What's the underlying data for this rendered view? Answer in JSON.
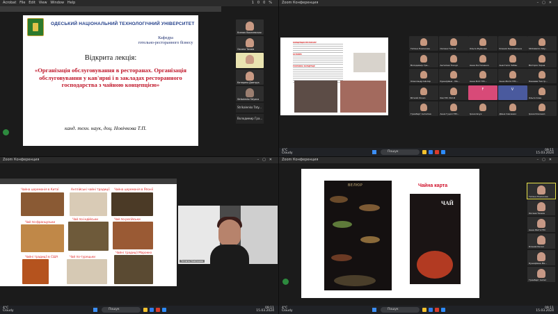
{
  "windows": {
    "top_left": {
      "app_menu": [
        "Acrobat",
        "File",
        "Edit",
        "View",
        "Window",
        "Help"
      ],
      "status": "100%"
    },
    "top_right": {
      "title": "Zoom Конференция"
    },
    "bottom_left": {
      "title": "Zoom Конференция"
    },
    "bottom_right": {
      "title": "Zoom Конференция"
    }
  },
  "slide1": {
    "university": "ОДЕСЬКИЙ НАЦІОНАЛЬНИЙ ТЕХНОЛОГІЧНИЙ УНІВЕРСИТЕТ",
    "department_line1": "Кафедра",
    "department_line2": "готельно-ресторанного бізнесу",
    "lecture_label": "Відкрита лекція:",
    "topic": "«Організація обслуговування в ресторанах. Організація обслуговування у кав'ярні і в закладах ресторанного господарства з чайною концепцією»",
    "author": "канд. техн. наук, доц. Новічкова Т.П."
  },
  "q1_participants": [
    {
      "name": "Ксения Киселевская"
    },
    {
      "name": "Оксана Тимків"
    },
    {
      "name": ""
    },
    {
      "name": "Катерина Дмитрук"
    },
    {
      "name": "Strikalenko Tatyana"
    }
  ],
  "q1_name_tiles": [
    "Strikalenko Taty...",
    "Володимир Гра..."
  ],
  "slide2": {
    "heading1": "КОНЦЕПЦІЯ РЕСТОРАНУ",
    "heading2": "ОСНОВНІ",
    "heading3": "РОЗРОБКА КОНЦЕПЦІЇ"
  },
  "q2_grid": [
    {
      "name": "Тетяна Новічкова"
    },
    {
      "name": "Оксана Тимків"
    },
    {
      "name": "Ольга Жуйкова"
    },
    {
      "name": "Ксения Киселевська"
    },
    {
      "name": "Strikalenko Taty..."
    },
    {
      "name": "Володимир Гра..."
    },
    {
      "name": "Ангеліна Ткачук"
    },
    {
      "name": "Анна Костюченко"
    },
    {
      "name": "Анастасія Чабан"
    },
    {
      "name": "Вікторія Чорна"
    },
    {
      "name": "Олександр Шкляр"
    },
    {
      "name": "Кушнірівна - Ма..."
    },
    {
      "name": "Анна Бліт ГРС..."
    },
    {
      "name": "Анна Житя ГРС..."
    },
    {
      "name": "Канаева Тая гр..."
    },
    {
      "name": "Віталій Лозко"
    },
    {
      "name": "Кім ГРС 302-Б"
    },
    {
      "name": "F"
    },
    {
      "name": "V"
    },
    {
      "name": "Ольга Сова"
    },
    {
      "name": "Гринберг Ангеліна"
    },
    {
      "name": "Анна Гуцол ГРС..."
    },
    {
      "name": "Ірина Івчук"
    },
    {
      "name": "Діана Савченко"
    },
    {
      "name": "Ірина Кокошко"
    }
  ],
  "slide3": {
    "captions": [
      "Чайна церемонія в Китаї",
      "Англійські чайні традиції",
      "Чайна церемонія в Японії",
      "Чай по-французьки",
      "Чай по-індійськи",
      "Чай по-російськи",
      "Чайні традиції в США",
      "Чай по-турецьки",
      "Чайні традиції Марокко"
    ]
  },
  "q3_video": {
    "name": "Тетяна Новічкова"
  },
  "slide4": {
    "title": "Чайна карта",
    "brand": "ВЕЛЮР",
    "menu_word": "ЧАЙ"
  },
  "q4_participants": [
    {
      "name": "Тетяна Новічкова"
    },
    {
      "name": "Оксана Тимків"
    },
    {
      "name": "Анна Житя ГРС"
    },
    {
      "name": "Ксения Кисел"
    },
    {
      "name": "Кушнірівна Ма..."
    },
    {
      "name": "Гринберг Ангел"
    }
  ],
  "taskbar": {
    "weather_temp": "4°C",
    "weather_text": "Cloudy",
    "search_placeholder": "Пошук",
    "lang": "УКР",
    "time": "09:11",
    "date": "15.03.2024"
  }
}
